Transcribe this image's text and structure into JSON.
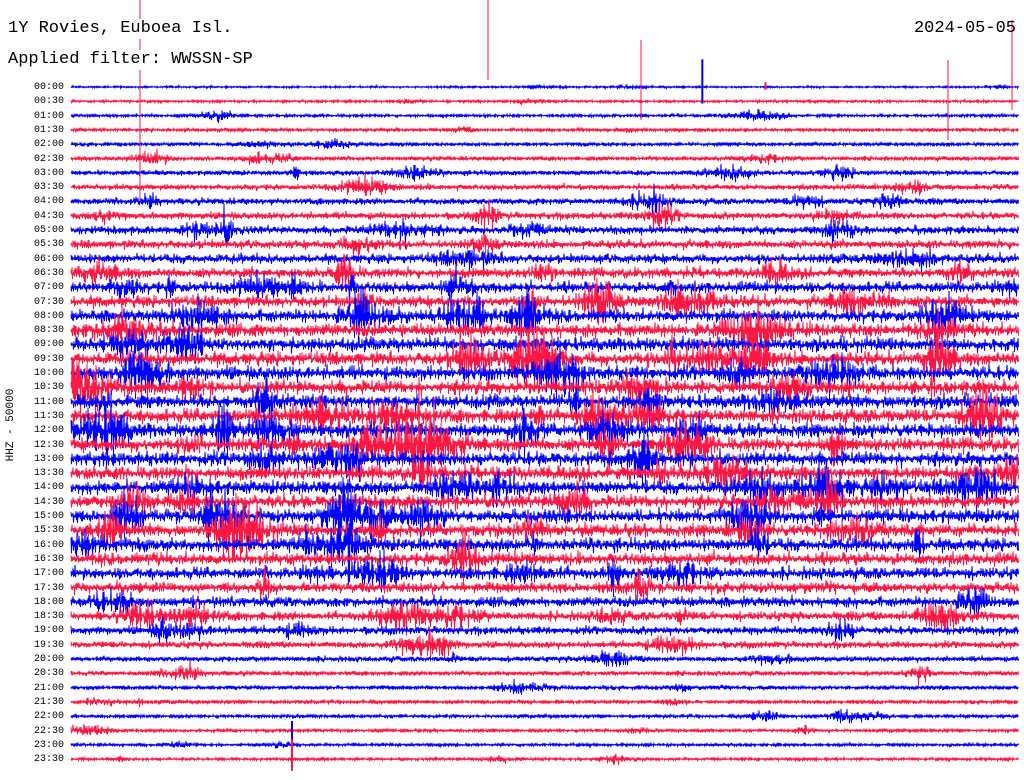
{
  "header": {
    "station": "1Y Rovies, Euboea Isl.",
    "filter": "Applied filter: WWSSN-SP",
    "date": "2024-05-05"
  },
  "chart_data": {
    "type": "helicorder",
    "ylabel": "HHZ - 50000",
    "row_labels": [
      "00:00",
      "00:30",
      "01:00",
      "01:30",
      "02:00",
      "02:30",
      "03:00",
      "03:30",
      "04:00",
      "04:30",
      "05:00",
      "05:30",
      "06:00",
      "06:30",
      "07:00",
      "07:30",
      "08:00",
      "08:30",
      "09:00",
      "09:30",
      "10:00",
      "10:30",
      "11:00",
      "11:30",
      "12:00",
      "12:30",
      "13:00",
      "13:30",
      "14:00",
      "14:30",
      "15:00",
      "15:30",
      "16:00",
      "16:30",
      "17:00",
      "17:30",
      "18:00",
      "18:30",
      "19:00",
      "19:30",
      "20:00",
      "20:30",
      "21:00",
      "21:30",
      "22:00",
      "22:30",
      "23:00",
      "23:30"
    ],
    "trace_colors": [
      "#0000ff",
      "#ff1744"
    ],
    "relative_amplitude": [
      0.25,
      0.32,
      0.38,
      0.42,
      0.46,
      0.55,
      0.65,
      0.75,
      0.85,
      0.95,
      1.05,
      1.15,
      1.25,
      1.35,
      1.45,
      1.55,
      1.65,
      1.75,
      1.8,
      1.85,
      1.85,
      1.85,
      1.85,
      1.85,
      1.85,
      1.85,
      1.85,
      1.85,
      1.8,
      1.8,
      1.8,
      1.75,
      1.7,
      1.65,
      1.55,
      1.45,
      1.35,
      1.2,
      1.05,
      0.9,
      0.7,
      0.6,
      0.55,
      0.5,
      0.45,
      0.42,
      0.4,
      0.38
    ],
    "notable_events": [
      {
        "row": 0,
        "minute": 20,
        "amplitude": 3.5,
        "color": "#0000ff"
      },
      {
        "row": 0,
        "minute": 22,
        "amplitude": 0.6,
        "color": "#ff1744"
      },
      {
        "row": 46,
        "minute": 7,
        "amplitude": 3.0,
        "color": "#0000ff"
      },
      {
        "row": 47,
        "minute": 7,
        "amplitude": 2.5,
        "color": "#ff1744"
      }
    ]
  }
}
